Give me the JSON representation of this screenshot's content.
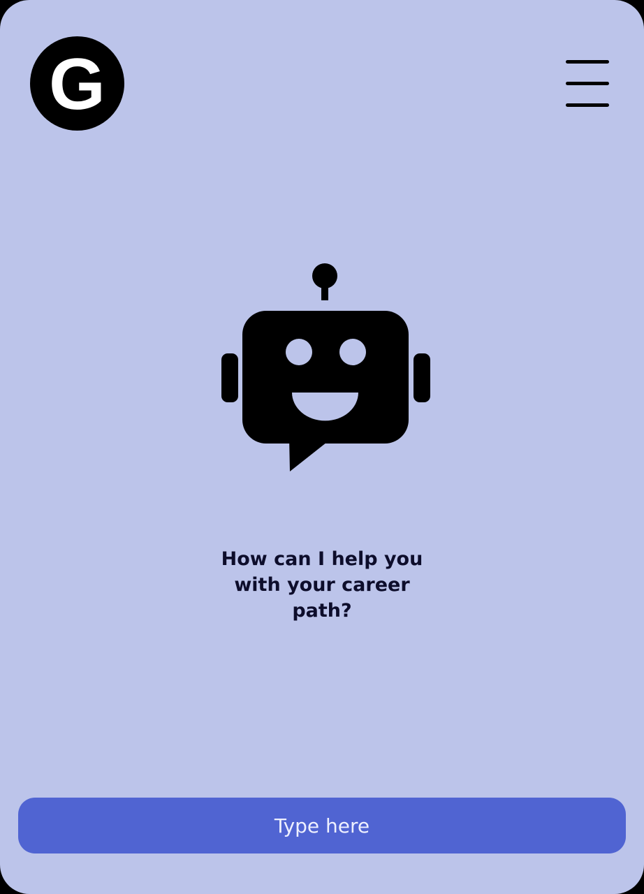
{
  "header": {
    "logo_letter": "G"
  },
  "icons": {
    "logo": "g-logo-icon",
    "menu": "hamburger-menu-icon",
    "assistant": "chatbot-robot-icon"
  },
  "main": {
    "prompt": "How can I help you with your career path?"
  },
  "chat_input": {
    "placeholder": "Type here",
    "value": ""
  },
  "colors": {
    "background": "#bcc4ea",
    "accent": "#5064d2",
    "icon": "#000000",
    "text": "#0d0d2b"
  }
}
